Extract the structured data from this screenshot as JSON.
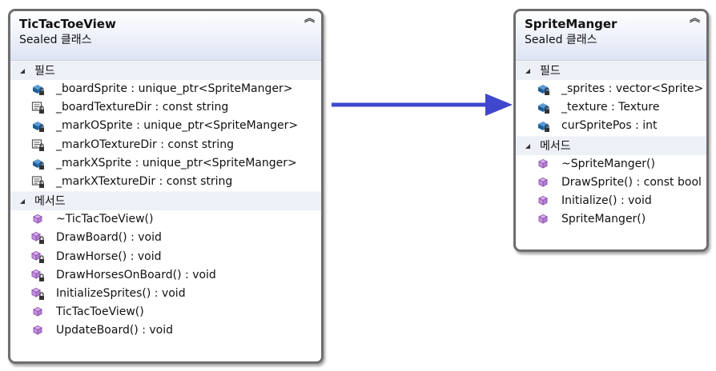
{
  "classes": {
    "tictactoe": {
      "name": "TicTacToeView",
      "stereotype": "Sealed 클래스",
      "fields_label": "필드",
      "methods_label": "메서드",
      "fields": [
        {
          "text": "_boardSprite : unique_ptr<SpriteManger>",
          "icon": "field-lock-icon"
        },
        {
          "text": "_boardTextureDir : const string",
          "icon": "const-lock-icon"
        },
        {
          "text": "_markOSprite : unique_ptr<SpriteManger>",
          "icon": "field-lock-icon"
        },
        {
          "text": "_markOTextureDir : const string",
          "icon": "const-lock-icon"
        },
        {
          "text": "_markXSprite : unique_ptr<SpriteManger>",
          "icon": "field-lock-icon"
        },
        {
          "text": "_markXTextureDir : const string",
          "icon": "const-lock-icon"
        }
      ],
      "methods": [
        {
          "text": "~TicTacToeView()",
          "icon": "method-icon"
        },
        {
          "text": "DrawBoard() : void",
          "icon": "method-lock-icon"
        },
        {
          "text": "DrawHorse() : void",
          "icon": "method-lock-icon"
        },
        {
          "text": "DrawHorsesOnBoard() : void",
          "icon": "method-lock-icon"
        },
        {
          "text": "InitializeSprites() : void",
          "icon": "method-lock-icon"
        },
        {
          "text": "TicTacToeView()",
          "icon": "method-icon"
        },
        {
          "text": "UpdateBoard() : void",
          "icon": "method-icon"
        }
      ]
    },
    "spritemanger": {
      "name": "SpriteManger",
      "stereotype": "Sealed 클래스",
      "fields_label": "필드",
      "methods_label": "메서드",
      "fields": [
        {
          "text": "_sprites : vector<Sprite>",
          "icon": "field-lock-icon"
        },
        {
          "text": "_texture : Texture",
          "icon": "field-lock-icon"
        },
        {
          "text": "curSpritePos : int",
          "icon": "field-lock-icon"
        }
      ],
      "methods": [
        {
          "text": "~SpriteManger()",
          "icon": "method-icon"
        },
        {
          "text": "DrawSprite() : const bool",
          "icon": "method-icon"
        },
        {
          "text": "Initialize() : void",
          "icon": "method-icon"
        },
        {
          "text": "SpriteManger()",
          "icon": "method-icon"
        }
      ]
    }
  },
  "colors": {
    "arrow": "#3f48cc",
    "field_icon": "#1e5c94",
    "method_icon": "#8e4fb0",
    "lock": "#333333"
  }
}
